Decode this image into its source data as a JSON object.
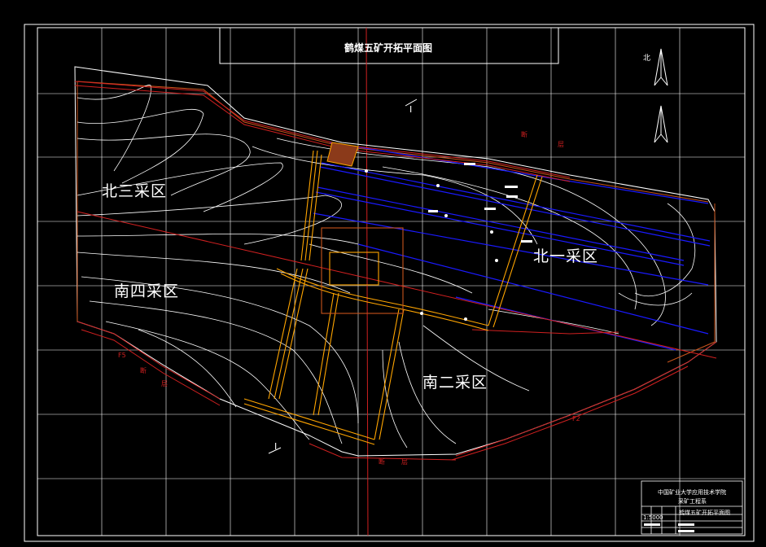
{
  "drawing": {
    "title": "鹤煤五矿开拓平面图",
    "north_label": "北",
    "section_mark_top": "I",
    "section_mark_bottom": "I"
  },
  "zones": [
    {
      "id": "north-one",
      "label": "北一采区"
    },
    {
      "id": "south-two",
      "label": "南二采区"
    },
    {
      "id": "north-three",
      "label": "北三采区"
    },
    {
      "id": "south-four",
      "label": "南四采区"
    }
  ],
  "faults": {
    "f5_label": "F5",
    "f2_label": "F2",
    "fault_word": "断",
    "layer_word": "层"
  },
  "title_block": {
    "institute": "中国矿业大学应用技术学院",
    "course": "采矿工程系",
    "scale": "1:5000",
    "drawing_name": "鹤煤五矿开拓平面图"
  },
  "colors": {
    "background": "#000000",
    "grid": "#ffffff",
    "contour": "#ffffff",
    "roadway": "#ffa500",
    "fault": "#d02020",
    "seam": "#1a1aff",
    "orange_boundary": "#c8541c"
  }
}
